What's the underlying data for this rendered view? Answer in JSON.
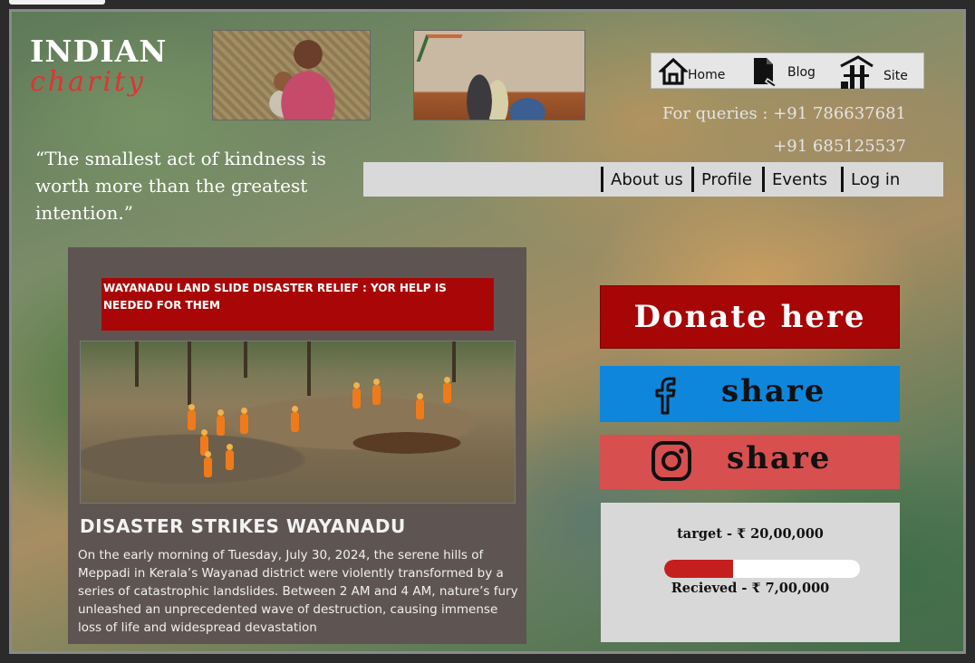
{
  "brand": {
    "line1": "INDIAN",
    "line2": "charity"
  },
  "nav": {
    "home": "Home",
    "blog": "Blog",
    "site": "Site"
  },
  "contact": {
    "label": "For queries : +91 786637681",
    "phone2": "+91 685125537"
  },
  "quote": "“The smallest act of kindness is worth more than the greatest intention.”",
  "menu": [
    "About us",
    "Profile",
    "Events",
    "Log in"
  ],
  "article": {
    "banner": "WAYANADU LAND SLIDE DISASTER RELIEF : YOR HELP IS NEEDED FOR THEM",
    "title": "DISASTER STRIKES WAYANADU",
    "body": "On the early morning of Tuesday, July 30, 2024, the serene hills of Meppadi in Kerala’s Wayanad district were violently transformed by a series of catastrophic landslides. Between 2 AM and 4 AM, nature’s fury unleashed an unprecedented wave of destruction, causing immense loss of life and widespread devastation"
  },
  "actions": {
    "donate": "Donate here",
    "facebook_share": "share",
    "instagram_share": "share"
  },
  "fundraising": {
    "target": "target - ₹ 20,00,000",
    "received": "Recieved - ₹ 7,00,000",
    "progress_fraction": 0.35
  },
  "colors": {
    "accent_red": "#a70606",
    "facebook_blue": "#0d86dc",
    "instagram_red": "#d84f4f"
  }
}
